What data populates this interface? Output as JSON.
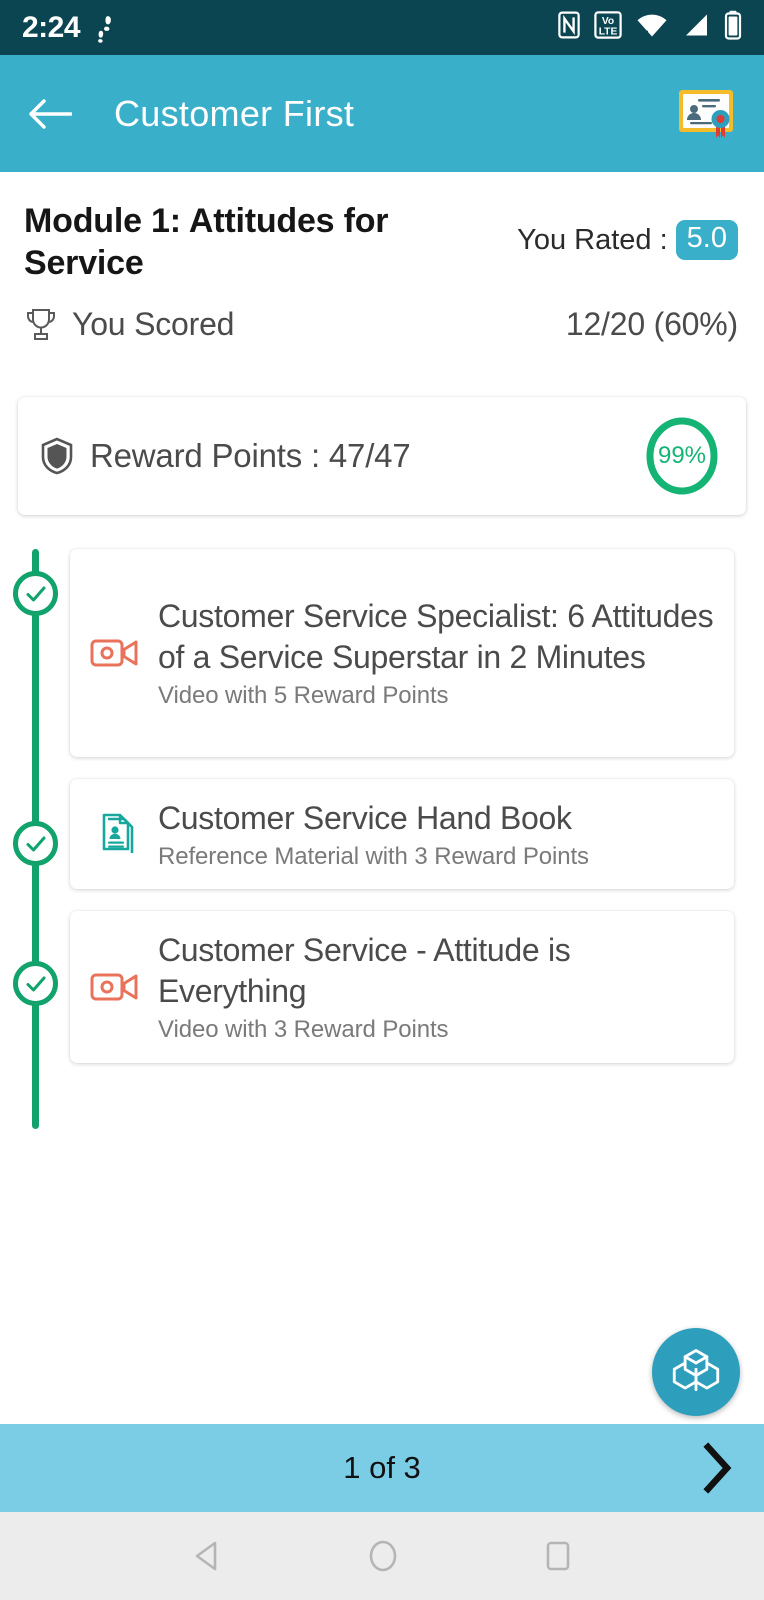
{
  "status_bar": {
    "time": "2:24",
    "icons": [
      "footsteps-icon",
      "nfc-icon",
      "volte-icon",
      "wifi-icon",
      "cellular-signal-icon",
      "battery-icon"
    ]
  },
  "app_bar": {
    "back_icon": "back-arrow-icon",
    "title": "Customer First",
    "certificate_icon": "certificate-icon"
  },
  "module": {
    "title": "Module 1: Attitudes for Service",
    "rating_label": "You Rated :",
    "rating_value": "5.0",
    "score_icon": "trophy-icon",
    "score_label": "You Scored",
    "score_value": "12/20 (60%)"
  },
  "reward": {
    "icon": "shield-icon",
    "text": "Reward Points : 47/47",
    "progress_percent": "99%",
    "progress_value": 99
  },
  "timeline": {
    "items": [
      {
        "icon": "video-camera-icon",
        "title": "Customer Service Specialist: 6 Attitudes of a Service Superstar in 2 Minutes",
        "subtitle": "Video with 5 Reward Points",
        "status": "completed"
      },
      {
        "icon": "document-reference-icon",
        "title": "Customer Service Hand Book",
        "subtitle": "Reference Material with 3 Reward Points",
        "status": "completed"
      },
      {
        "icon": "video-camera-icon",
        "title": "Customer Service - Attitude is Everything",
        "subtitle": "Video with 3 Reward Points",
        "status": "completed"
      }
    ]
  },
  "fab": {
    "icon": "openai-knot-icon"
  },
  "pager": {
    "label": "1 of 3",
    "next_icon": "chevron-right-icon"
  },
  "nav_bar": {
    "back_icon": "nav-back-triangle-icon",
    "home_icon": "nav-home-circle-icon",
    "recents_icon": "nav-recents-square-icon"
  },
  "colors": {
    "status_bar_bg": "#0b4551",
    "app_bar_bg": "#3aafca",
    "accent_teal": "#3aafca",
    "timeline_green": "#11a36b",
    "progress_green": "#15b474",
    "video_icon": "#e8735a",
    "document_icon": "#18a79d",
    "pager_bg": "#7bcde6",
    "nav_bar_bg": "#ececec"
  }
}
